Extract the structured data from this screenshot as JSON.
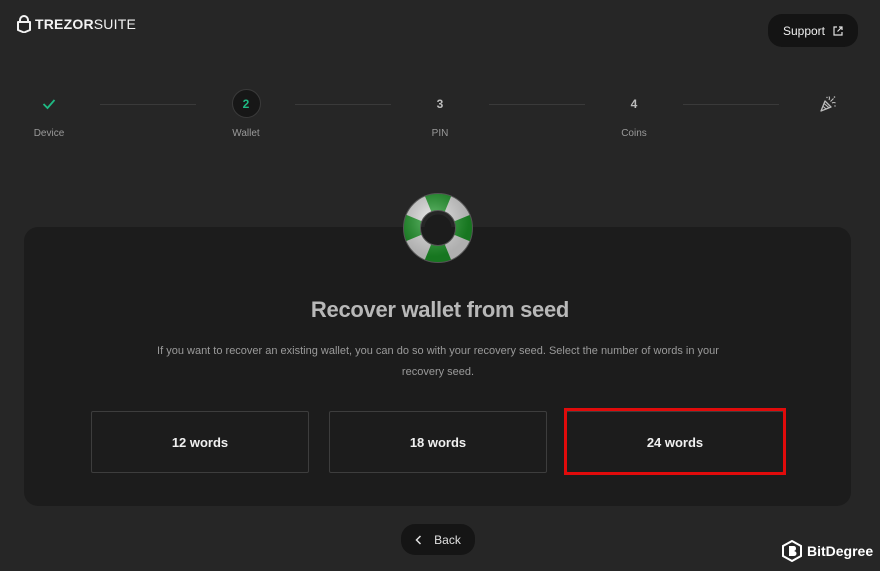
{
  "header": {
    "brand_bold": "TREZOR",
    "brand_light": "SUITE",
    "support_label": "Support"
  },
  "stepper": {
    "accent_color": "#1fb983",
    "steps": [
      {
        "marker": "✓",
        "label": "Device",
        "state": "done"
      },
      {
        "marker": "2",
        "label": "Wallet",
        "state": "active"
      },
      {
        "marker": "3",
        "label": "PIN",
        "state": "pending"
      },
      {
        "marker": "4",
        "label": "Coins",
        "state": "pending"
      },
      {
        "marker": "party-popper-icon",
        "label": "",
        "state": "pending"
      }
    ]
  },
  "main": {
    "title": "Recover wallet from seed",
    "description": "If you want to recover an existing wallet, you can do so with your recovery seed. Select the number of words in your recovery seed.",
    "options": [
      {
        "label": "12 words"
      },
      {
        "label": "18 words"
      },
      {
        "label": "24 words",
        "highlighted": true
      }
    ],
    "highlight_color": "#e00b0b",
    "back_label": "Back"
  },
  "watermark": {
    "text": "BitDegree"
  }
}
